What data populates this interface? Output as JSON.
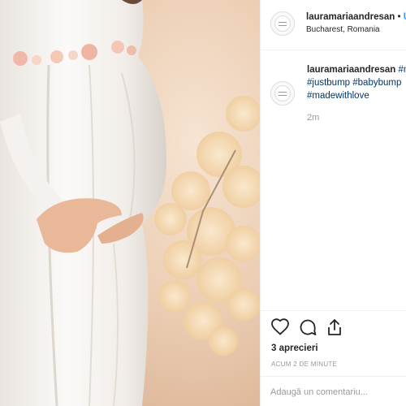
{
  "header": {
    "username": "lauramariaandresan",
    "separator": "•",
    "follow_label": "U",
    "location": "Bucharest, Romania",
    "avatar_icon": "profile-avatar"
  },
  "caption": {
    "username": "lauramariaandresan",
    "line1_tag": "#n",
    "line2": "#justbump #babybump",
    "line3": "#madewithlove",
    "time": "2m"
  },
  "actions": {
    "like_icon": "heart-icon",
    "comment_icon": "comment-icon",
    "share_icon": "share-icon",
    "likes_text": "3 aprecieri",
    "posted_ago": "ACUM 2 DE MINUTE",
    "comment_placeholder": "Adaugă un comentariu..."
  },
  "colors": {
    "link": "#003569",
    "follow": "#3897f0",
    "muted": "#999999",
    "border": "#efefef"
  }
}
